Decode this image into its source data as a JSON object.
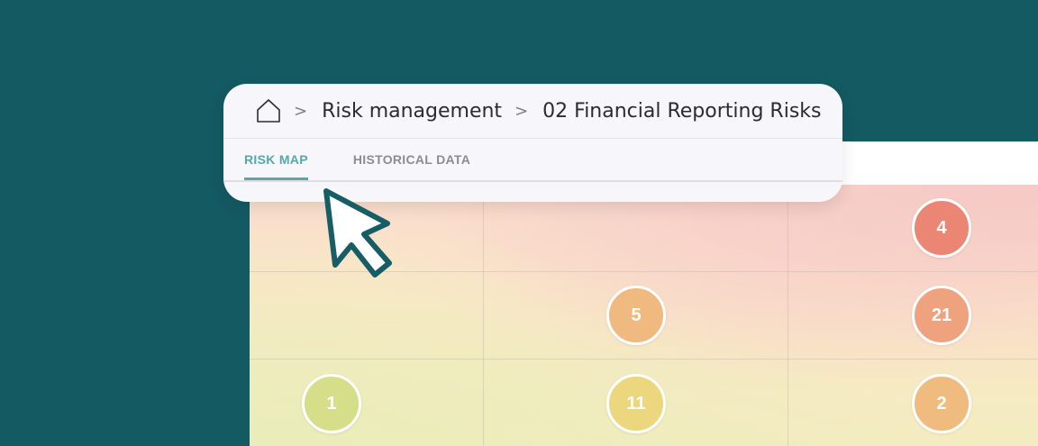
{
  "breadcrumb": {
    "home_icon": "home-icon",
    "separator": ">",
    "items": [
      "Risk management",
      "02 Financial Reporting Risks"
    ]
  },
  "tabs": [
    {
      "label": "RISK MAP",
      "active": true
    },
    {
      "label": "HISTORICAL DATA",
      "active": false
    }
  ],
  "colors": {
    "background": "#145a63",
    "accent": "#56a8ab",
    "risk_high": "#ec8674",
    "risk_medium_high": "#eea27e",
    "risk_medium": "#efb97f",
    "risk_low_medium": "#ecd67e",
    "risk_low": "#d7de89"
  },
  "risk_map": {
    "dots": [
      {
        "label": "4",
        "row": 0,
        "col": 2,
        "color": "#ec8674"
      },
      {
        "label": "5",
        "row": 1,
        "col": 1,
        "color": "#efb97f"
      },
      {
        "label": "21",
        "row": 1,
        "col": 2,
        "color": "#eea27e"
      },
      {
        "label": "1",
        "row": 2,
        "col": 0,
        "color": "#d7de89"
      },
      {
        "label": "11",
        "row": 2,
        "col": 1,
        "color": "#ecd67e"
      },
      {
        "label": "2",
        "row": 2,
        "col": 2,
        "color": "#efbb7f"
      }
    ]
  },
  "cursor_icon": "pointer-cursor-icon"
}
